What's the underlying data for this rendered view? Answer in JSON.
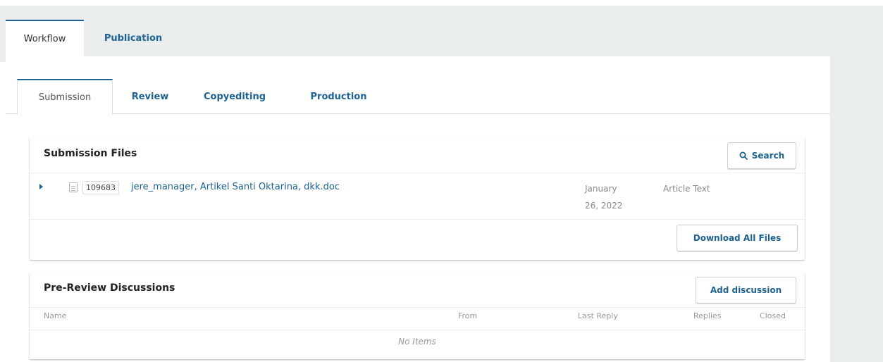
{
  "main_tabs": [
    {
      "label": "Workflow",
      "active": true
    },
    {
      "label": "Publication",
      "active": false
    }
  ],
  "sub_tabs": [
    {
      "label": "Submission",
      "active": true
    },
    {
      "label": "Review",
      "active": false
    },
    {
      "label": "Copyediting",
      "active": false
    },
    {
      "label": "Production",
      "active": false
    }
  ],
  "submission_files": {
    "title": "Submission Files",
    "search_label": "Search",
    "files": [
      {
        "id": "109683",
        "name": "jere_manager, Artikel Santi Oktarina, dkk.doc",
        "date_line1": "January",
        "date_line2": "26, 2022",
        "type": "Article Text"
      }
    ],
    "download_all_label": "Download All Files"
  },
  "discussions": {
    "title": "Pre-Review Discussions",
    "add_label": "Add discussion",
    "columns": [
      "Name",
      "From",
      "Last Reply",
      "Replies",
      "Closed"
    ],
    "empty_text": "No Items"
  },
  "colors": {
    "accent": "#1e6292",
    "background": "#eaedee"
  }
}
